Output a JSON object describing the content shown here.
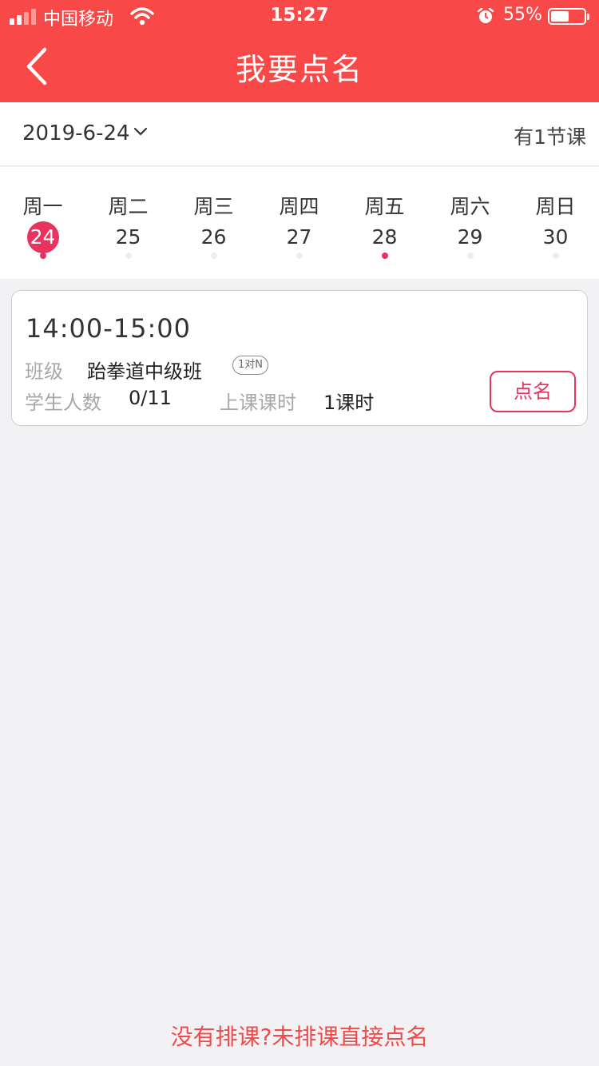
{
  "status_bar": {
    "carrier": "中国移动",
    "time": "15:27",
    "battery": "55%",
    "battery_level": 0.55,
    "icons": [
      "signal-icon",
      "wifi-icon",
      "alarm-icon",
      "battery-icon"
    ]
  },
  "nav": {
    "title": "我要点名",
    "back_icon": "chevron-left-icon"
  },
  "date_bar": {
    "date": "2019-6-24",
    "dropdown_icon": "chevron-down-icon",
    "lesson_count": "有1节课"
  },
  "week": [
    {
      "weekday": "周一",
      "day": "24",
      "selected": true,
      "has_lesson": true
    },
    {
      "weekday": "周二",
      "day": "25",
      "selected": false,
      "has_lesson": false
    },
    {
      "weekday": "周三",
      "day": "26",
      "selected": false,
      "has_lesson": false
    },
    {
      "weekday": "周四",
      "day": "27",
      "selected": false,
      "has_lesson": false
    },
    {
      "weekday": "周五",
      "day": "28",
      "selected": false,
      "has_lesson": true
    },
    {
      "weekday": "周六",
      "day": "29",
      "selected": false,
      "has_lesson": false
    },
    {
      "weekday": "周日",
      "day": "30",
      "selected": false,
      "has_lesson": false
    }
  ],
  "lesson_card": {
    "time": "14:00-15:00",
    "class_label": "班级",
    "class_name": "跆拳道中级班",
    "class_type_badge": "1对N",
    "students_label": "学生人数",
    "students_value": "0/11",
    "hours_label": "上课课时",
    "hours_value": "1课时",
    "call_button": "点名"
  },
  "bottom_link": "没有排课?未排课直接点名",
  "colors": {
    "header": "#f94848",
    "accent": "#e8335f",
    "link": "#f24a4a",
    "background": "#f2f2f4"
  }
}
